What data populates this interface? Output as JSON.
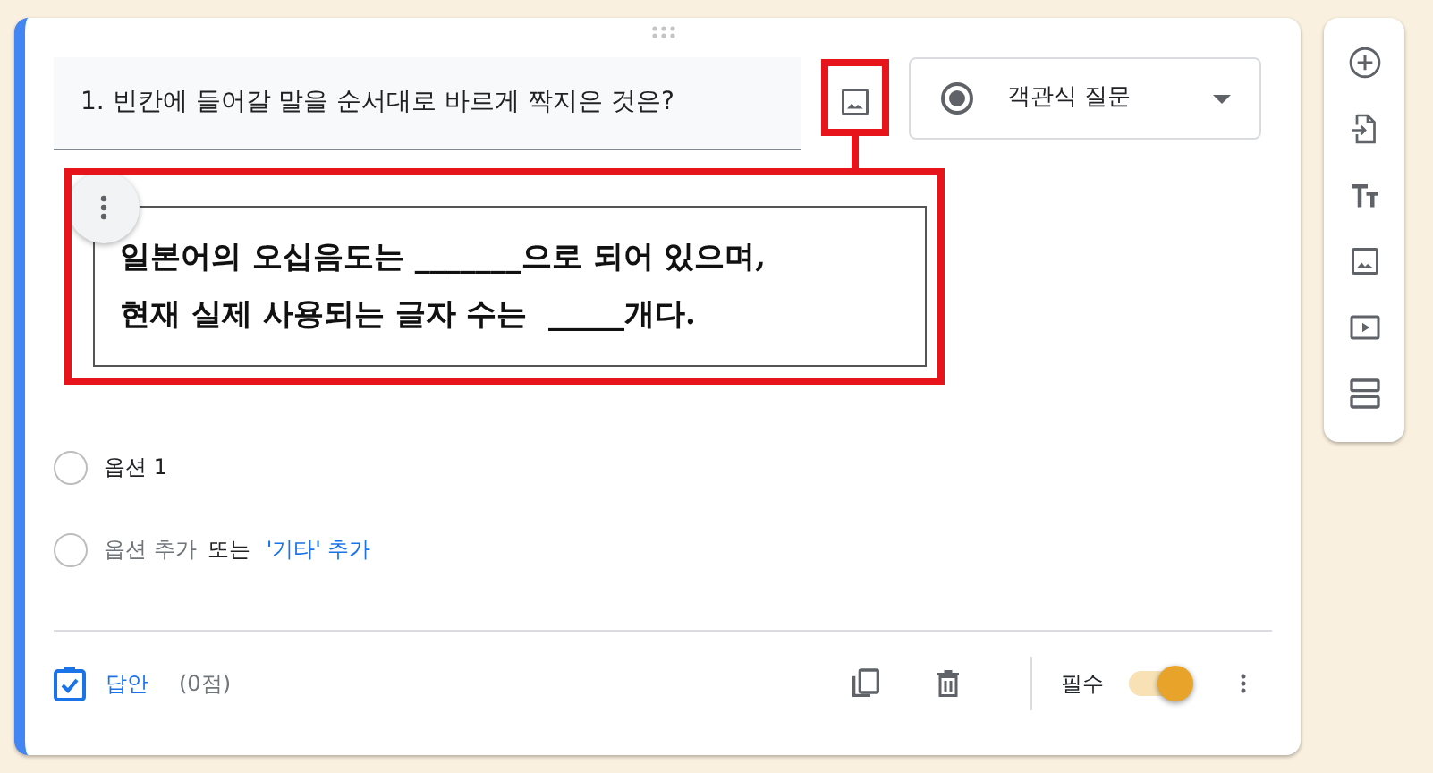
{
  "question": {
    "title": "1. 빈칸에 들어갈 말을 순서대로 바르게 짝지은 것은?"
  },
  "type_dropdown": {
    "label": "객관식 질문"
  },
  "question_image": {
    "lines": [
      "일본어의 오십음도는 _______으로 되어 있으며,",
      "현재 실제 사용되는 글자 수는  _____개다."
    ]
  },
  "options": [
    {
      "kind": "option",
      "checked": false,
      "label": "옵션 1"
    },
    {
      "kind": "add",
      "checked": false,
      "label": "옵션 추가",
      "joiner": "또는",
      "other_link": "'기타' 추가"
    }
  ],
  "footer": {
    "answer_key": "답안",
    "points": "(0점)",
    "required_label": "필수",
    "required": true
  }
}
